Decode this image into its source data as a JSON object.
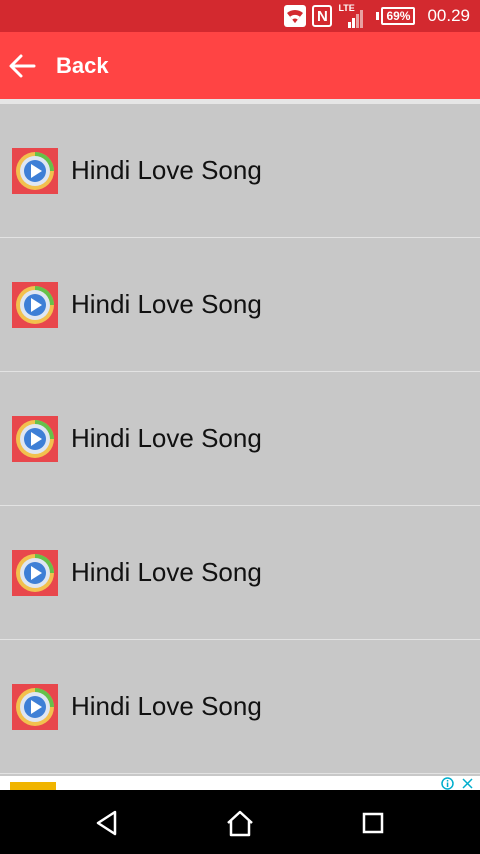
{
  "status_bar": {
    "network_label": "LTE",
    "battery": "69%",
    "time": "00.29",
    "nfc_label": "N"
  },
  "app_bar": {
    "back_label": "Back"
  },
  "songs": [
    {
      "title": "Hindi Love Song"
    },
    {
      "title": "Hindi Love Song"
    },
    {
      "title": "Hindi Love Song"
    },
    {
      "title": "Hindi Love Song"
    },
    {
      "title": "Hindi Love Song"
    }
  ],
  "colors": {
    "status_bar": "#d3292f",
    "app_bar": "#ff4444",
    "list_background": "#c8c8c8",
    "nav_bar": "#000000"
  },
  "icons": {
    "song": "media-player-icon",
    "back": "arrow-left-icon",
    "nav": [
      "back-triangle-icon",
      "home-icon",
      "recents-square-icon"
    ]
  }
}
